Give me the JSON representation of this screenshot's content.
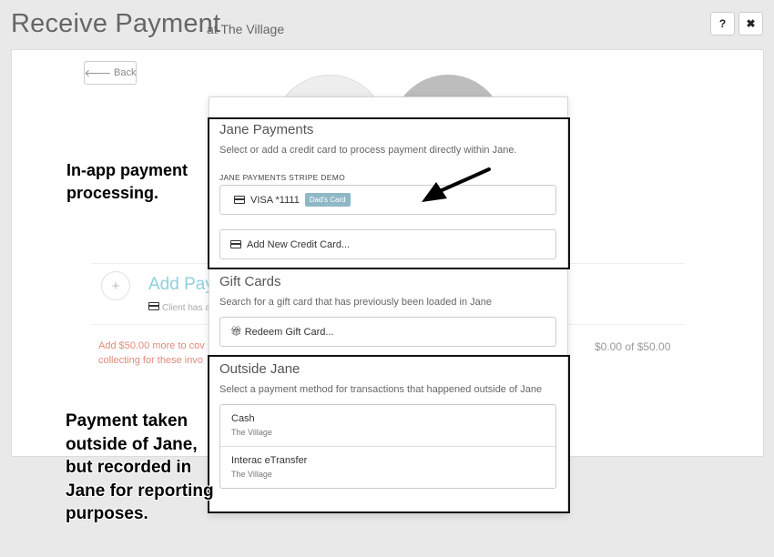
{
  "header": {
    "title": "Receive Payment",
    "subtitle": "at The Village",
    "help_label": "?",
    "close_label": "✖"
  },
  "main": {
    "back_label": "Back",
    "add_payment_label": "Add Pay",
    "add_payment_icon": "+",
    "client_note": "Client has a c",
    "warning_line1": "Add $50.00 more to cov",
    "warning_line2": "collecting for these invo",
    "amount_text": "$0.00 of $50.00"
  },
  "dropdown": {
    "jane_payments": {
      "title": "Jane Payments",
      "description": "Select or add a credit card to process payment directly within Jane.",
      "provider_label": "JANE PAYMENTS STRIPE DEMO",
      "card_label": "VISA *1111",
      "card_badge": "Dad's Card",
      "add_card_label": "Add New Credit Card..."
    },
    "gift_cards": {
      "title": "Gift Cards",
      "description": "Search for a gift card that has previously been loaded in Jane",
      "redeem_label": "Redeem Gift Card..."
    },
    "outside_jane": {
      "title": "Outside Jane",
      "description": "Select a payment method for transactions that happened outside of Jane",
      "methods": [
        {
          "name": "Cash",
          "location": "The Village"
        },
        {
          "name": "Interac eTransfer",
          "location": "The Village"
        }
      ]
    }
  },
  "annotations": {
    "in_app_line1": "In-app payment",
    "in_app_line2": "processing.",
    "outside_line1": "Payment taken",
    "outside_line2": "outside of Jane,",
    "outside_line3": "but recorded in",
    "outside_line4": "Jane for reporting",
    "outside_line5": "purposes."
  },
  "colors": {
    "accent_teal": "#8fd0dc",
    "warning": "#e08a7a",
    "badge": "#8fb8c7"
  }
}
